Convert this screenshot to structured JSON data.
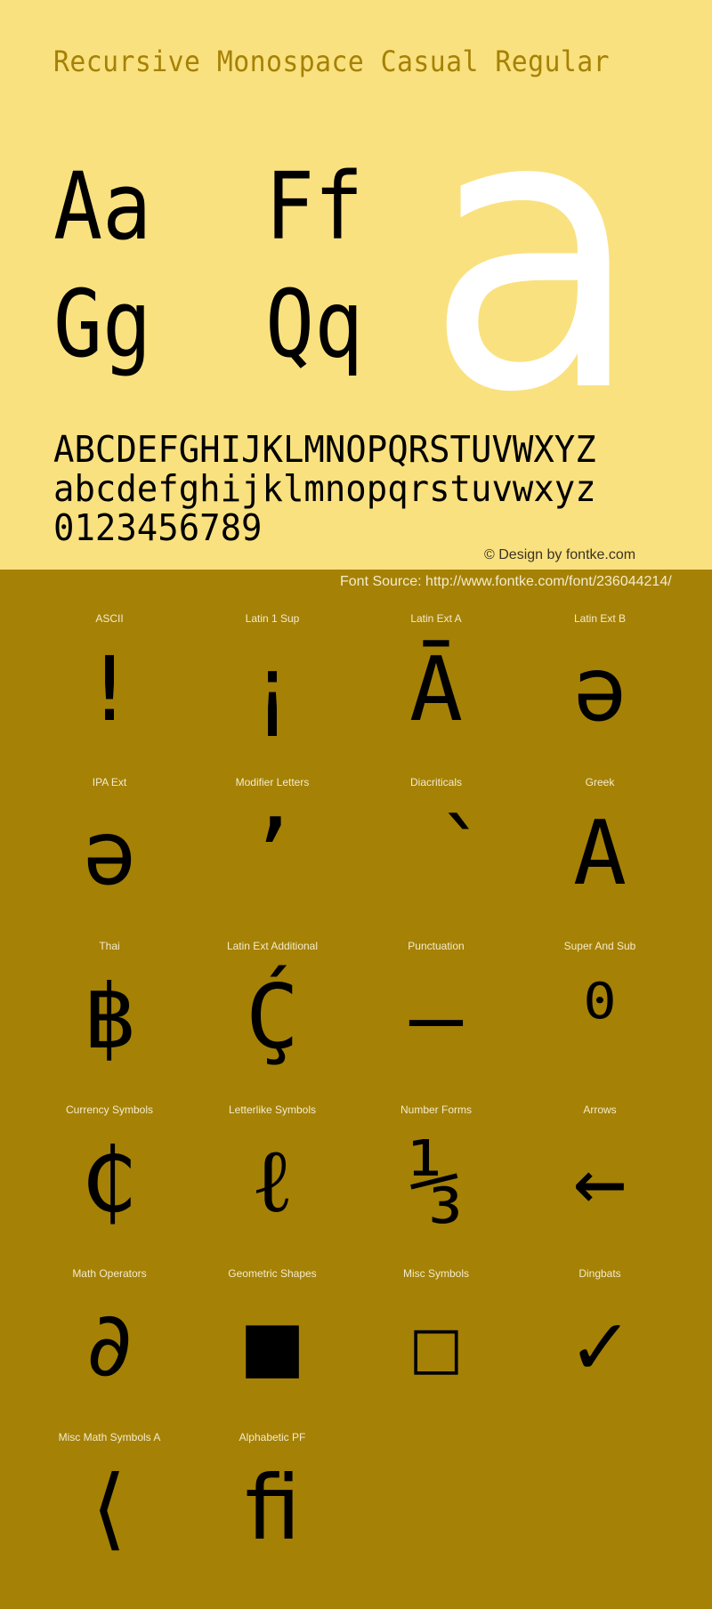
{
  "header": {
    "title": "Recursive Monospace Casual Regular"
  },
  "specimen": {
    "pairs": [
      "Aa",
      "Ff",
      "Gg",
      "Qq"
    ],
    "big_glyph": "a",
    "uppercase": "ABCDEFGHIJKLMNOPQRSTUVWXYZ",
    "lowercase": "abcdefghijklmnopqrstuvwxyz",
    "digits": "0123456789"
  },
  "credit": "© Design by fontke.com",
  "source": "Font Source: http://www.fontke.com/font/236044214/",
  "colors": {
    "top_background": "#fae17f",
    "bottom_background": "#a58106",
    "title_color": "#a58106",
    "big_glyph_color": "#ffffff",
    "label_color": "#f4eccb"
  },
  "grid": [
    {
      "label": "ASCII",
      "glyph": "!"
    },
    {
      "label": "Latin 1 Sup",
      "glyph": "¡"
    },
    {
      "label": "Latin Ext A",
      "glyph": "Ā"
    },
    {
      "label": "Latin Ext B",
      "glyph": "ə"
    },
    {
      "label": "IPA Ext",
      "glyph": "ə"
    },
    {
      "label": "Modifier Letters",
      "glyph": "ʼ"
    },
    {
      "label": "Diacriticals",
      "glyph": "̀"
    },
    {
      "label": "Greek",
      "glyph": "Α"
    },
    {
      "label": "Thai",
      "glyph": "฿"
    },
    {
      "label": "Latin Ext Additional",
      "glyph": "Ḉ"
    },
    {
      "label": "Punctuation",
      "glyph": "‒"
    },
    {
      "label": "Super And Sub",
      "glyph": "⁰"
    },
    {
      "label": "Currency Symbols",
      "glyph": "₵"
    },
    {
      "label": "Letterlike Symbols",
      "glyph": "ℓ"
    },
    {
      "label": "Number Forms",
      "glyph": "⅓"
    },
    {
      "label": "Arrows",
      "glyph": "←"
    },
    {
      "label": "Math Operators",
      "glyph": "∂"
    },
    {
      "label": "Geometric Shapes",
      "glyph": "■"
    },
    {
      "label": "Misc Symbols",
      "glyph": "☐"
    },
    {
      "label": "Dingbats",
      "glyph": "✓"
    },
    {
      "label": "Misc Math Symbols A",
      "glyph": "⟨"
    },
    {
      "label": "Alphabetic PF",
      "glyph": "ﬁ"
    }
  ]
}
